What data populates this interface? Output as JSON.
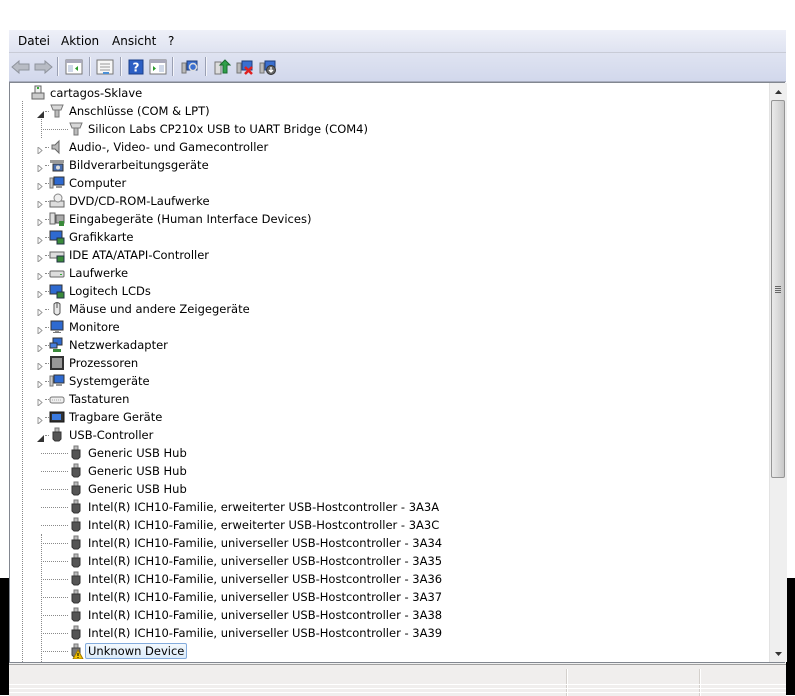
{
  "menu": {
    "items": [
      "Datei",
      "Aktion",
      "Ansicht",
      "?"
    ]
  },
  "toolbar": {
    "buttons": [
      {
        "name": "back-button",
        "icon": "arrow-left-icon",
        "enabled": false
      },
      {
        "name": "forward-button",
        "icon": "arrow-right-icon",
        "enabled": false
      },
      {
        "name": "show-hide-console-tree-button",
        "icon": "console-tree-icon"
      },
      {
        "name": "properties-button",
        "icon": "properties-icon"
      },
      {
        "name": "help-button",
        "icon": "help-icon"
      },
      {
        "name": "show-hide-action-pane-button",
        "icon": "action-pane-icon"
      },
      {
        "name": "scan-hardware-button",
        "icon": "scan-hardware-icon"
      },
      {
        "name": "update-driver-button",
        "icon": "update-driver-icon"
      },
      {
        "name": "uninstall-button",
        "icon": "uninstall-icon"
      },
      {
        "name": "disable-button",
        "icon": "disable-device-icon"
      }
    ]
  },
  "tree": {
    "root": {
      "label": "cartagos-Sklave",
      "icon": "computer-host-icon",
      "expanded": true
    },
    "nodes": [
      {
        "label": "Anschlüsse (COM & LPT)",
        "icon": "port-icon",
        "level": 1,
        "expander": "expanded"
      },
      {
        "label": "Silicon Labs CP210x USB to UART Bridge (COM4)",
        "icon": "port-icon",
        "level": 2,
        "expander": "none"
      },
      {
        "label": "Audio-, Video- und Gamecontroller",
        "icon": "speaker-icon",
        "level": 1,
        "expander": "collapsed"
      },
      {
        "label": "Bildverarbeitungsgeräte",
        "icon": "imaging-device-icon",
        "level": 1,
        "expander": "collapsed"
      },
      {
        "label": "Computer",
        "icon": "computer-icon",
        "level": 1,
        "expander": "collapsed"
      },
      {
        "label": "DVD/CD-ROM-Laufwerke",
        "icon": "dvd-drive-icon",
        "level": 1,
        "expander": "collapsed"
      },
      {
        "label": "Eingabegeräte (Human Interface Devices)",
        "icon": "hid-icon",
        "level": 1,
        "expander": "collapsed"
      },
      {
        "label": "Grafikkarte",
        "icon": "display-adapter-icon",
        "level": 1,
        "expander": "collapsed"
      },
      {
        "label": "IDE ATA/ATAPI-Controller",
        "icon": "ide-controller-icon",
        "level": 1,
        "expander": "collapsed"
      },
      {
        "label": "Laufwerke",
        "icon": "disk-drive-icon",
        "level": 1,
        "expander": "collapsed"
      },
      {
        "label": "Logitech LCDs",
        "icon": "lcd-icon",
        "level": 1,
        "expander": "collapsed"
      },
      {
        "label": "Mäuse und andere Zeigegeräte",
        "icon": "mouse-icon",
        "level": 1,
        "expander": "collapsed"
      },
      {
        "label": "Monitore",
        "icon": "monitor-icon",
        "level": 1,
        "expander": "collapsed"
      },
      {
        "label": "Netzwerkadapter",
        "icon": "network-adapter-icon",
        "level": 1,
        "expander": "collapsed"
      },
      {
        "label": "Prozessoren",
        "icon": "processor-icon",
        "level": 1,
        "expander": "collapsed"
      },
      {
        "label": "Systemgeräte",
        "icon": "system-device-icon",
        "level": 1,
        "expander": "collapsed"
      },
      {
        "label": "Tastaturen",
        "icon": "keyboard-icon",
        "level": 1,
        "expander": "collapsed"
      },
      {
        "label": "Tragbare Geräte",
        "icon": "portable-device-icon",
        "level": 1,
        "expander": "collapsed"
      },
      {
        "label": "USB-Controller",
        "icon": "usb-icon",
        "level": 1,
        "expander": "expanded"
      },
      {
        "label": "Generic USB Hub",
        "icon": "usb-icon",
        "level": 2,
        "expander": "none"
      },
      {
        "label": "Generic USB Hub",
        "icon": "usb-icon",
        "level": 2,
        "expander": "none"
      },
      {
        "label": "Generic USB Hub",
        "icon": "usb-icon",
        "level": 2,
        "expander": "none"
      },
      {
        "label": "Intel(R) ICH10-Familie, erweiterter USB-Hostcontroller - 3A3A",
        "icon": "usb-icon",
        "level": 2,
        "expander": "none"
      },
      {
        "label": "Intel(R) ICH10-Familie, erweiterter USB-Hostcontroller - 3A3C",
        "icon": "usb-icon",
        "level": 2,
        "expander": "none"
      },
      {
        "label": "Intel(R) ICH10-Familie, universeller USB-Hostcontroller - 3A34",
        "icon": "usb-icon",
        "level": 2,
        "expander": "none"
      },
      {
        "label": "Intel(R) ICH10-Familie, universeller USB-Hostcontroller - 3A35",
        "icon": "usb-icon",
        "level": 2,
        "expander": "none"
      },
      {
        "label": "Intel(R) ICH10-Familie, universeller USB-Hostcontroller - 3A36",
        "icon": "usb-icon",
        "level": 2,
        "expander": "none"
      },
      {
        "label": "Intel(R) ICH10-Familie, universeller USB-Hostcontroller - 3A37",
        "icon": "usb-icon",
        "level": 2,
        "expander": "none"
      },
      {
        "label": "Intel(R) ICH10-Familie, universeller USB-Hostcontroller - 3A38",
        "icon": "usb-icon",
        "level": 2,
        "expander": "none"
      },
      {
        "label": "Intel(R) ICH10-Familie, universeller USB-Hostcontroller - 3A39",
        "icon": "usb-icon",
        "level": 2,
        "expander": "none"
      },
      {
        "label": "Unknown Device",
        "icon": "usb-warning-icon",
        "level": 2,
        "expander": "none",
        "selected": true,
        "warning": true
      }
    ]
  },
  "scrollbar": {
    "thumb_start_fraction": 0.0,
    "visible_fraction": 0.68
  },
  "statusbar": {
    "sections": [
      "",
      "",
      ""
    ]
  },
  "colors": {
    "selection_border": "#84acdd",
    "warning": "#f5c400",
    "menubar": "#dfe3f1"
  }
}
